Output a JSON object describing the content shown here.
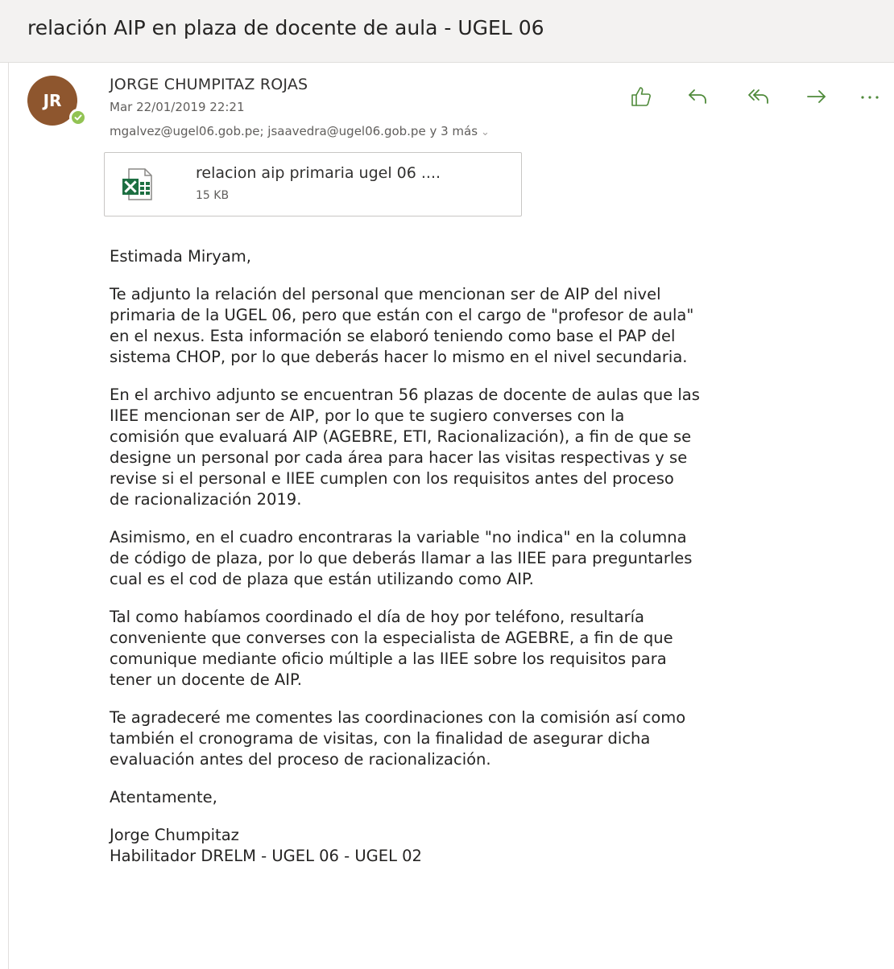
{
  "subject": "relación AIP en plaza de docente de aula - UGEL 06",
  "sender": {
    "initials": "JR",
    "name": "JORGE CHUMPITAZ ROJAS",
    "date": "Mar 22/01/2019 22:21",
    "recipients": "mgalvez@ugel06.gob.pe; jsaavedra@ugel06.gob.pe y 3 más",
    "avatar_color": "#8e562e",
    "presence_color": "#92c353"
  },
  "actions": [
    {
      "icon": "like-icon"
    },
    {
      "icon": "reply-icon"
    },
    {
      "icon": "reply-all-icon"
    },
    {
      "icon": "forward-icon"
    },
    {
      "icon": "more-icon"
    }
  ],
  "attachment": {
    "name": "relacion aip primaria ugel 06 ....",
    "size": "15 KB",
    "icon": "excel-file-icon",
    "icon_color": "#1d6f42"
  },
  "body": {
    "greeting": "Estimada Miryam,",
    "p1": "Te adjunto la relación del personal que mencionan ser de AIP del nivel\nprimaria de la UGEL 06, pero que están con el cargo de \"profesor de aula\"\nen el nexus. Esta información se elaboró teniendo como base el PAP del\nsistema CHOP, por lo que deberás hacer lo mismo en el nivel secundaria.",
    "p2": "En el archivo adjunto se encuentran 56 plazas de docente de aulas que las\nIIEE mencionan ser de AIP, por lo que te sugiero converses con la\ncomisión que evaluará AIP (AGEBRE, ETI, Racionalización), a fin de que se\ndesigne un personal por cada área para hacer las visitas respectivas y se\nrevise si el personal e IIEE cumplen con los requisitos antes del proceso\nde racionalización 2019.",
    "p3": "Asimismo, en el cuadro encontraras la variable \"no indica\" en la columna\nde código de plaza, por lo que deberás llamar a las IIEE para preguntarles\ncual es el cod de plaza que están utilizando como AIP.",
    "p4": "Tal como habíamos coordinado el día de hoy por teléfono, resultaría\nconveniente que converses con la especialista de AGEBRE, a fin de que\ncomunique mediante oficio múltiple a las IIEE sobre los requisitos para\ntener un docente de AIP.",
    "p5": "Te agradeceré me comentes las coordinaciones con la comisión así como\ntambién el cronograma de visitas, con la finalidad de asegurar dicha\nevaluación antes del proceso de racionalización.",
    "closing": "Atentamente,",
    "signature": "Jorge Chumpitaz\nHabilitador DRELM - UGEL 06 - UGEL 02"
  }
}
